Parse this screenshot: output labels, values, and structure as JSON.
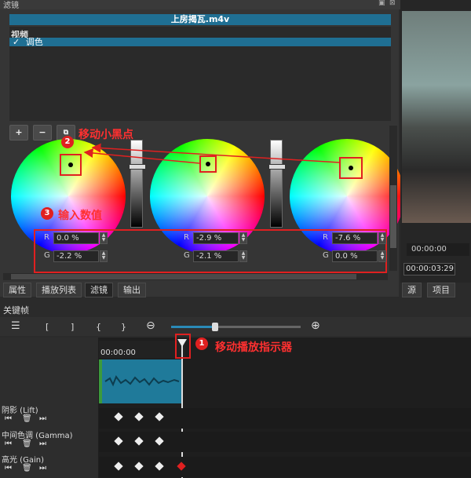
{
  "panel": {
    "title": "滤镜"
  },
  "clip": {
    "name": "上房揭瓦.m4v"
  },
  "filters": {
    "category": "视频",
    "items": [
      {
        "check": "✓",
        "label": "调色"
      }
    ]
  },
  "toolbar": {
    "add": "+",
    "remove": "−"
  },
  "wheels": [
    {
      "id": "lift",
      "fields": [
        {
          "label": "R",
          "value": "0.0 %"
        },
        {
          "label": "G",
          "value": "-2.2 %"
        }
      ]
    },
    {
      "id": "gamma",
      "fields": [
        {
          "label": "R",
          "value": "-2.9 %"
        },
        {
          "label": "G",
          "value": "-2.1 %"
        }
      ]
    },
    {
      "id": "gain",
      "fields": [
        {
          "label": "R",
          "value": "-7.6 %"
        },
        {
          "label": "G",
          "value": "0.0 %"
        }
      ]
    }
  ],
  "annotations": {
    "a1": {
      "num": "1",
      "text": "移动播放指示器"
    },
    "a2": {
      "num": "2",
      "text": "移动小黑点"
    },
    "a3": {
      "num": "3",
      "text": "输入数值"
    }
  },
  "tabs": {
    "left": [
      {
        "label": "属性"
      },
      {
        "label": "播放列表"
      },
      {
        "label": "滤镜",
        "active": true
      },
      {
        "label": "输出"
      }
    ],
    "right": [
      {
        "label": "源"
      },
      {
        "label": "项目"
      }
    ]
  },
  "player": {
    "time1": "00:00:00",
    "time2": "00:00:03:29"
  },
  "keyframes": {
    "title": "关键帧",
    "toolbar": [
      "☰",
      "[",
      "]",
      "{",
      "}"
    ],
    "ruler_time": "00:00:00",
    "tracks": [
      {
        "label": "阴影 (Lift)"
      },
      {
        "label": "中间色调 (Gamma)"
      },
      {
        "label": "高光 (Gain)"
      }
    ]
  },
  "colors": {
    "accent": "#1f6f93",
    "annotation": "#e02020",
    "waveform": "#1f7a9a",
    "clip_green": "#3c9a3c"
  }
}
